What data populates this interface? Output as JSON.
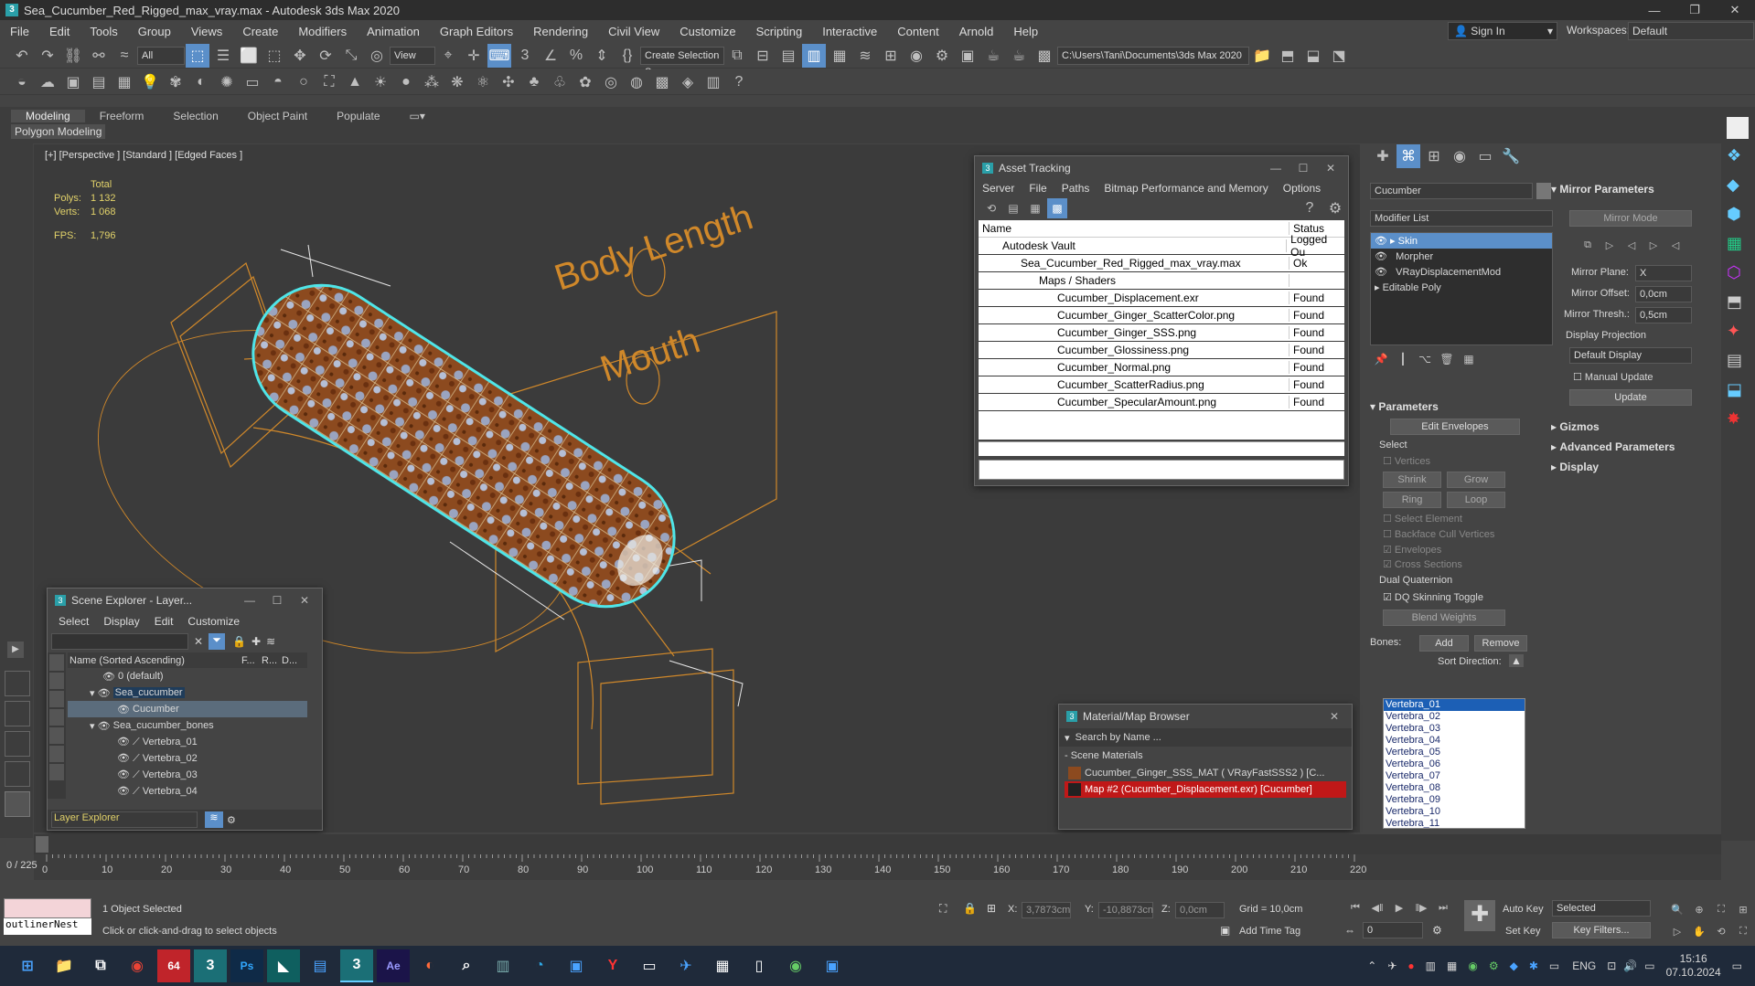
{
  "window": {
    "title": "Sea_Cucumber_Red_Rigged_max_vray.max - Autodesk 3ds Max 2020"
  },
  "menu": [
    "File",
    "Edit",
    "Tools",
    "Group",
    "Views",
    "Create",
    "Modifiers",
    "Animation",
    "Graph Editors",
    "Rendering",
    "Civil View",
    "Customize",
    "Scripting",
    "Interactive",
    "Content",
    "Arnold",
    "Help"
  ],
  "account": {
    "signin": "Sign In",
    "workspaces_label": "Workspaces:",
    "workspace": "Default"
  },
  "toolbar": {
    "filter": "All",
    "refcoord": "View",
    "selset": "Create Selection Se",
    "path": "C:\\Users\\Tani\\Documents\\3ds Max 2020"
  },
  "ribbon": {
    "tabs": [
      "Modeling",
      "Freeform",
      "Selection",
      "Object Paint",
      "Populate"
    ],
    "panel": "Polygon Modeling"
  },
  "viewport": {
    "label": "[+] [Perspective ] [Standard ] [Edged Faces ]",
    "stats": {
      "total_label": "Total",
      "polys_label": "Polys:",
      "polys": "1 132",
      "verts_label": "Verts:",
      "verts": "1 068",
      "fps_label": "FPS:",
      "fps": "1,796"
    },
    "board_text": [
      "Body Length",
      "Mouth"
    ]
  },
  "asset_tracking": {
    "title": "Asset Tracking",
    "menu": [
      "Server",
      "File",
      "Paths",
      "Bitmap Performance and Memory",
      "Options"
    ],
    "columns": [
      "Name",
      "Status"
    ],
    "rows": [
      {
        "name": "Autodesk Vault",
        "status": "Logged Ou"
      },
      {
        "name": "Sea_Cucumber_Red_Rigged_max_vray.max",
        "status": "Ok"
      },
      {
        "name": "Maps / Shaders",
        "status": ""
      },
      {
        "name": "Cucumber_Displacement.exr",
        "status": "Found"
      },
      {
        "name": "Cucumber_Ginger_ScatterColor.png",
        "status": "Found"
      },
      {
        "name": "Cucumber_Ginger_SSS.png",
        "status": "Found"
      },
      {
        "name": "Cucumber_Glossiness.png",
        "status": "Found"
      },
      {
        "name": "Cucumber_Normal.png",
        "status": "Found"
      },
      {
        "name": "Cucumber_ScatterRadius.png",
        "status": "Found"
      },
      {
        "name": "Cucumber_SpecularAmount.png",
        "status": "Found"
      }
    ]
  },
  "scene_explorer": {
    "title": "Scene Explorer - Layer...",
    "menu": [
      "Select",
      "Display",
      "Edit",
      "Customize"
    ],
    "header": "Name (Sorted Ascending)",
    "cols": [
      "F...",
      "R...",
      "D..."
    ],
    "rows": [
      "0 (default)",
      "Sea_cucumber",
      "Cucumber",
      "Sea_cucumber_bones",
      "Vertebra_01",
      "Vertebra_02",
      "Vertebra_03",
      "Vertebra_04"
    ],
    "footer": "Layer Explorer"
  },
  "material_browser": {
    "title": "Material/Map Browser",
    "search": "Search by Name ...",
    "group": "- Scene Materials",
    "items": [
      "Cucumber_Ginger_SSS_MAT  ( VRayFastSSS2 )  [C...",
      "Map #2 (Cucumber_Displacement.exr)  [Cucumber]"
    ]
  },
  "modify_panel": {
    "object_name": "Cucumber",
    "modifier_list": "Modifier List",
    "stack": [
      "Skin",
      "Morpher",
      "VRayDisplacementMod",
      "Editable Poly"
    ],
    "parameters": {
      "title": "Parameters",
      "edit_envelopes": "Edit Envelopes",
      "select_label": "Select",
      "vertices": "Vertices",
      "shrink": "Shrink",
      "grow": "Grow",
      "ring": "Ring",
      "loop": "Loop",
      "select_element": "Select Element",
      "backface": "Backface Cull Vertices",
      "envelopes": "Envelopes",
      "cross_sections": "Cross Sections",
      "dual_quat": "Dual Quaternion",
      "dq_toggle": "DQ Skinning Toggle",
      "blend_weights": "Blend Weights",
      "bones_label": "Bones:",
      "add": "Add",
      "remove": "Remove",
      "sort_direction": "Sort Direction:",
      "bones": [
        "Vertebra_01",
        "Vertebra_02",
        "Vertebra_03",
        "Vertebra_04",
        "Vertebra_05",
        "Vertebra_06",
        "Vertebra_07",
        "Vertebra_08",
        "Vertebra_09",
        "Vertebra_10",
        "Vertebra_11"
      ]
    },
    "mirror": {
      "title": "Mirror Parameters",
      "mode": "Mirror Mode",
      "plane_label": "Mirror Plane:",
      "plane": "X",
      "offset_label": "Mirror Offset:",
      "offset": "0,0cm",
      "thresh_label": "Mirror Thresh.:",
      "thresh": "0,5cm",
      "projection_label": "Display Projection",
      "projection": "Default Display",
      "manual": "Manual Update",
      "update": "Update"
    },
    "rollouts": [
      "Gizmos",
      "Advanced Parameters",
      "Display"
    ]
  },
  "timeline": {
    "frame": "0 / 225",
    "ticks": [
      "0",
      "10",
      "20",
      "30",
      "40",
      "50",
      "60",
      "70",
      "80",
      "90",
      "100",
      "110",
      "120",
      "130",
      "140",
      "150",
      "160",
      "170",
      "180",
      "190",
      "200",
      "210",
      "220"
    ]
  },
  "status": {
    "selected": "1 Object Selected",
    "hint": "Click or click-and-drag to select objects",
    "script": "outlinerNest",
    "x_label": "X:",
    "x": "3,7873cm",
    "y_label": "Y:",
    "y": "-10,8873cn",
    "z_label": "Z:",
    "z": "0,0cm",
    "grid": "Grid = 10,0cm",
    "add_time_tag": "Add Time Tag",
    "auto_key": "Auto Key",
    "set_key": "Set Key",
    "selected_dd": "Selected",
    "key_filters": "Key Filters...",
    "frame_field": "0"
  },
  "taskbar": {
    "lang": "ENG",
    "time": "15:16",
    "date": "07.10.2024"
  }
}
